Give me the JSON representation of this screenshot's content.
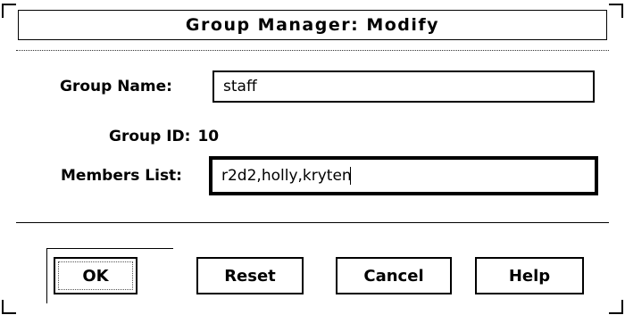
{
  "window": {
    "title": "Group Manager: Modify"
  },
  "form": {
    "group_name_label": "Group Name:",
    "group_name_value": "staff",
    "group_id_label": "Group ID:",
    "group_id_value": "10",
    "members_label": "Members List:",
    "members_value": "r2d2,holly,kryten"
  },
  "buttons": {
    "ok": "OK",
    "reset": "Reset",
    "cancel": "Cancel",
    "help": "Help"
  }
}
